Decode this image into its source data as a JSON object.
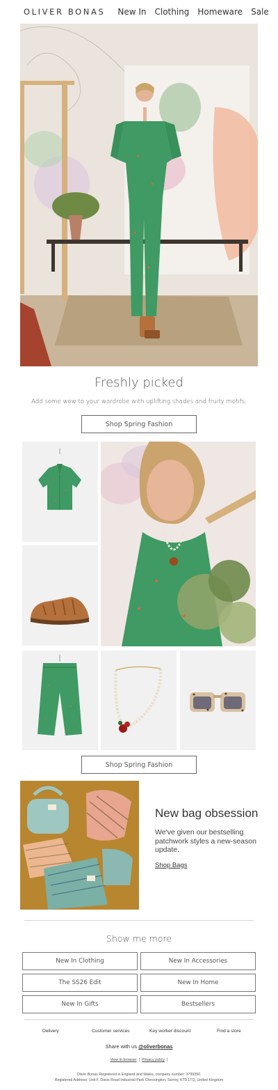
{
  "header": {
    "logo": "OLIVER BONAS",
    "nav": [
      "New In",
      "Clothing",
      "Homeware",
      "Sale"
    ]
  },
  "hero": {
    "heading": "Freshly picked",
    "subheading": "Add some wow to your wardrobe with uplifting shades and fruity motifs.",
    "cta": "Shop Spring Fashion"
  },
  "products": {
    "cta": "Shop Spring Fashion"
  },
  "bags": {
    "heading": "New bag obsession",
    "body": "We've given our bestselling patchwork styles a new-season update.",
    "link": "Shop Bags"
  },
  "more": {
    "heading": "Show me more",
    "buttons": [
      "New In Clothing",
      "New In Accessories",
      "The SS26 Edit",
      "New In Home",
      "New In Gifts",
      "Bestsellers"
    ]
  },
  "footer": {
    "links": [
      "Delivery",
      "Customer services",
      "Key worker discount",
      "Find a store"
    ],
    "share_prefix": "Share with us",
    "share_handle": "@oliverbonas",
    "view_in_browser": "View in browser",
    "privacy_policy": "Privacy policy",
    "legal_line1": "Oliver Bonas Registered in England and Wales, company number: 3799350.",
    "legal_line2": "Registered Address: Unit F, Davis Road Industrial Park Chessington, Surrey, KT9 1TQ, United Kingdom"
  },
  "colors": {
    "print_green": "#3f9a63",
    "tan_leather": "#b5713b",
    "wall_pink": "#e9cfcf",
    "tulle_peach": "#f2b79a"
  }
}
